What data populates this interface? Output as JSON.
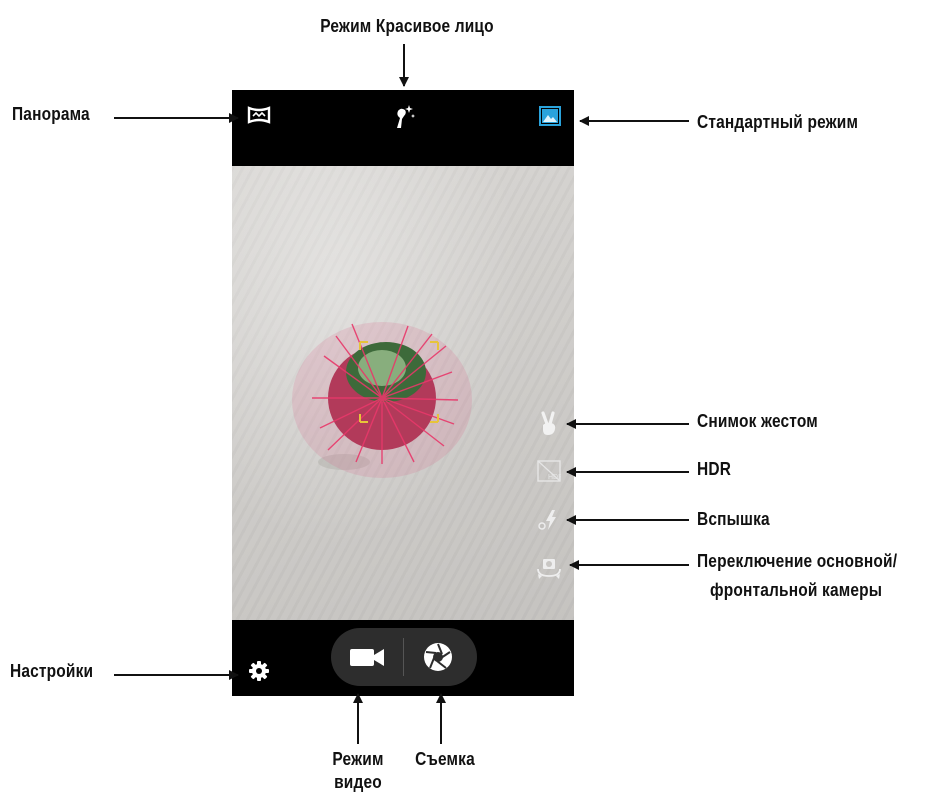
{
  "annotations": {
    "beauty_face": "Режим Красивое лицо",
    "panorama": "Панорама",
    "standard_mode": "Стандартный режим",
    "gesture_shot": "Снимок жестом",
    "hdr": "HDR",
    "flash": "Вспышка",
    "switch_camera_line1": "Переключение основной/",
    "switch_camera_line2": "фронтальной камеры",
    "settings": "Настройки",
    "video_mode_line1": "Режим",
    "video_mode_line2": "видео",
    "shoot": "Съемка"
  },
  "icons": {
    "panorama": "panorama-icon",
    "beauty_face": "beauty-face-icon",
    "standard_mode": "standard-mode-icon",
    "gesture_shot": "gesture-hand-icon",
    "hdr": "hdr-icon",
    "flash": "flash-auto-icon",
    "switch_camera": "switch-camera-icon",
    "settings": "gear-icon",
    "video": "video-camera-icon",
    "shutter": "shutter-icon"
  },
  "colors": {
    "accent": "#2aa3dc",
    "bars": "#000000",
    "pill": "#2d2d2d",
    "cactus_spines": "#e8386a",
    "cactus_body": "#3d6a3a"
  }
}
